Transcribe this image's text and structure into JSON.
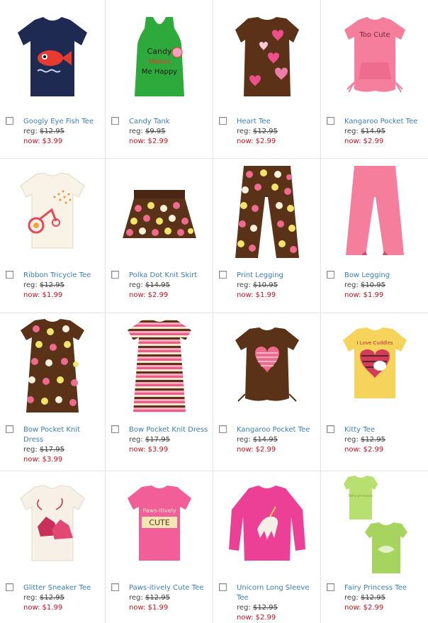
{
  "products": [
    {
      "name": "Googly Eye Fish Tee",
      "reg_label": "reg:",
      "reg_price": "$12.95",
      "now_label": "now:",
      "now_price": "$3.99",
      "icon": "fish-tee",
      "colors": {
        "main": "#1f2a52",
        "accent": "#e63b2e"
      }
    },
    {
      "name": "Candy Tank",
      "reg_label": "reg:",
      "reg_price": "$9.95",
      "now_label": "now:",
      "now_price": "$2.99",
      "icon": "candy-tank",
      "colors": {
        "main": "#2eaa3c",
        "accent": "#1f1f1f"
      }
    },
    {
      "name": "Heart Tee",
      "reg_label": "reg:",
      "reg_price": "$12.95",
      "now_label": "now:",
      "now_price": "$2.99",
      "icon": "heart-tee",
      "colors": {
        "main": "#5b3218",
        "accent": "#ef4f8c"
      }
    },
    {
      "name": "Kangaroo Pocket Tee",
      "reg_label": "reg:",
      "reg_price": "$14.95",
      "now_label": "now:",
      "now_price": "$2.99",
      "icon": "kangaroo-pocket-tee",
      "colors": {
        "main": "#f57e9c",
        "accent": "#7a2436"
      }
    },
    {
      "name": "Ribbon Tricycle Tee",
      "reg_label": "reg:",
      "reg_price": "$12.95",
      "now_label": "now:",
      "now_price": "$1.99",
      "icon": "tricycle-tee",
      "colors": {
        "main": "#f8f3e6",
        "accent": "#e8455a"
      }
    },
    {
      "name": "Polka Dot Knit Skirt",
      "reg_label": "reg:",
      "reg_price": "$14.95",
      "now_label": "now:",
      "now_price": "$2.99",
      "icon": "polka-dot-skirt",
      "colors": {
        "main": "#5a3218",
        "accent": "#f2e46a"
      }
    },
    {
      "name": "Print Legging",
      "reg_label": "reg:",
      "reg_price": "$10.95",
      "now_label": "now:",
      "now_price": "$1.99",
      "icon": "polka-legging",
      "colors": {
        "main": "#5a3218",
        "accent": "#ee6b8e"
      }
    },
    {
      "name": "Bow Legging",
      "reg_label": "reg:",
      "reg_price": "$10.95",
      "now_label": "now:",
      "now_price": "$1.99",
      "icon": "bow-legging",
      "colors": {
        "main": "#f57e9c",
        "accent": "#c9506d"
      }
    },
    {
      "name": "Bow Pocket Knit Dress",
      "reg_label": "reg:",
      "reg_price": "$17.95",
      "now_label": "now:",
      "now_price": "$3.99",
      "icon": "polka-dress",
      "colors": {
        "main": "#5a3218",
        "accent": "#ee6b8e"
      }
    },
    {
      "name": "Bow Pocket Knit Dress",
      "reg_label": "reg:",
      "reg_price": "$17.95",
      "now_label": "now:",
      "now_price": "$3.99",
      "icon": "striped-dress",
      "colors": {
        "main": "#f2c0cf",
        "accent": "#5a3218"
      }
    },
    {
      "name": "Kangaroo Pocket Tee",
      "reg_label": "reg:",
      "reg_price": "$14.95",
      "now_label": "now:",
      "now_price": "$2.99",
      "icon": "heart-pocket-tee",
      "colors": {
        "main": "#5a3218",
        "accent": "#ee6b8e"
      }
    },
    {
      "name": "Kitty Tee",
      "reg_label": "reg:",
      "reg_price": "$12.95",
      "now_label": "now:",
      "now_price": "$2.99",
      "icon": "kitty-tee",
      "colors": {
        "main": "#f6d35b",
        "accent": "#d63c5a"
      }
    },
    {
      "name": "Glitter Sneaker Tee",
      "reg_label": "reg:",
      "reg_price": "$12.95",
      "now_label": "now:",
      "now_price": "$1.99",
      "icon": "sneaker-tee",
      "colors": {
        "main": "#f6f0e6",
        "accent": "#c8305a"
      }
    },
    {
      "name": "Paws-itively Cute Tee",
      "reg_label": "reg:",
      "reg_price": "$12.95",
      "now_label": "now:",
      "now_price": "$1.99",
      "icon": "paws-cute-tee",
      "colors": {
        "main": "#f25e98",
        "accent": "#f4e7b5"
      }
    },
    {
      "name": "Unicorn Long Sleeve Tee",
      "reg_label": "reg:",
      "reg_price": "$12.95",
      "now_label": "now:",
      "now_price": "$2.99",
      "icon": "unicorn-tee",
      "colors": {
        "main": "#ec3f96",
        "accent": "#f3eee6"
      }
    },
    {
      "name": "Fairy Princess Tee",
      "reg_label": "reg:",
      "reg_price": "$12.95",
      "now_label": "now:",
      "now_price": "$2.99",
      "icon": "fairy-tee",
      "colors": {
        "main": "#b8e070",
        "accent": "#8cbf3e"
      }
    }
  ]
}
